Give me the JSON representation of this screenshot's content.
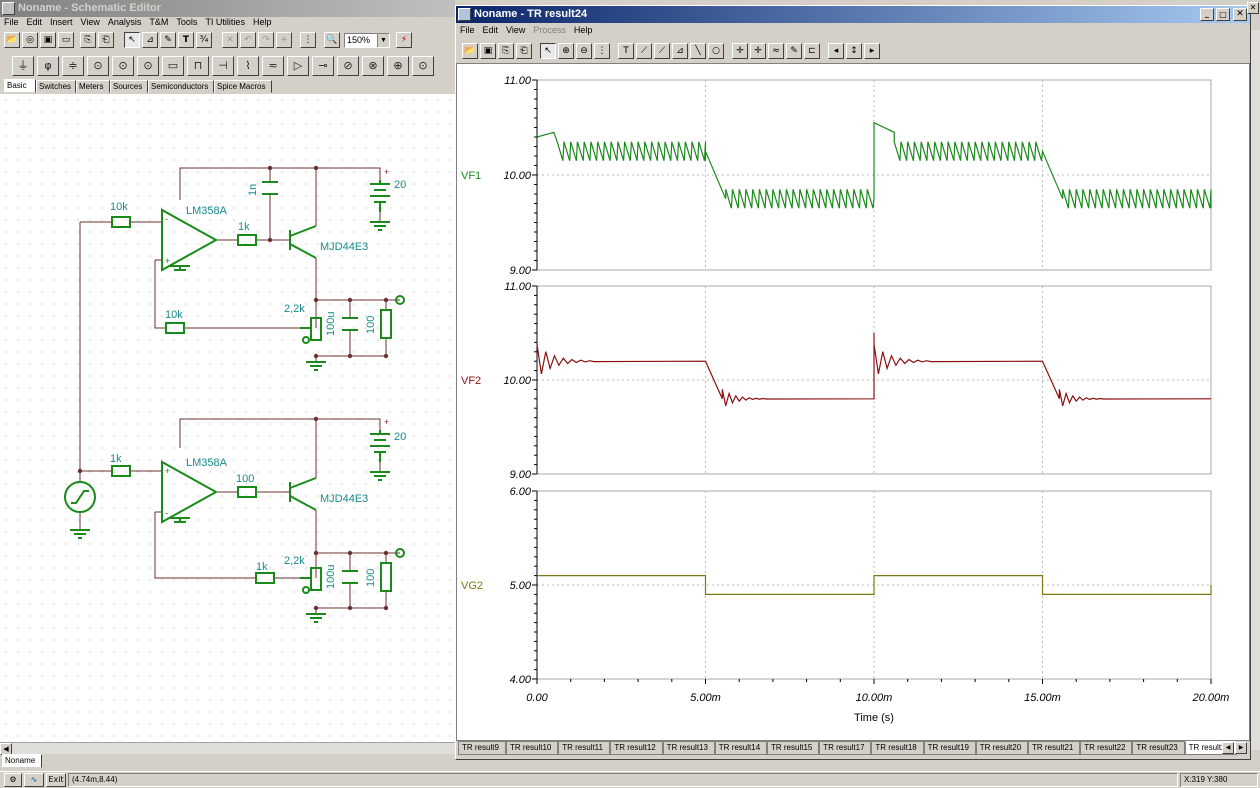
{
  "schematic_window": {
    "title": "Noname - Schematic Editor",
    "menu": [
      "File",
      "Edit",
      "Insert",
      "View",
      "Analysis",
      "T&M",
      "Tools",
      "TI Utilities",
      "Help"
    ],
    "zoom": "150%",
    "component_tabs": [
      "Basic",
      "Switches",
      "Meters",
      "Sources",
      "Semiconductors",
      "Spice Macros"
    ],
    "active_component_tab": "Basic",
    "doc_tab": "Noname",
    "labels": {
      "r_in_top": "10k",
      "opamp_top": "LM358A",
      "r_base_top": "1k",
      "cap_top": "1n",
      "transistor_top": "MJD44E3",
      "battery_top": "20",
      "plus_top": "+",
      "r_fb_top": "10k",
      "pot_top": "2,2k",
      "cap_out_top": "100u",
      "r_load_top": "100",
      "r_in_bot": "1k",
      "opamp_bot": "LM358A",
      "r_base_bot": "100",
      "transistor_bot": "MJD44E3",
      "battery_bot": "20",
      "plus_bot": "+",
      "r_fb_bot": "1k",
      "pot_bot": "2,2k",
      "cap_out_bot": "100u",
      "r_load_bot": "100",
      "plus_sign": "+",
      "minus_sign": "-"
    }
  },
  "result_window": {
    "title": "Noname - TR result24",
    "menu": [
      {
        "label": "File",
        "disabled": false
      },
      {
        "label": "Edit",
        "disabled": false
      },
      {
        "label": "View",
        "disabled": false
      },
      {
        "label": "Process",
        "disabled": true
      },
      {
        "label": "Help",
        "disabled": false
      }
    ],
    "tabs": [
      "TR result9",
      "TR result10",
      "TR result11",
      "TR result12",
      "TR result13",
      "TR result14",
      "TR result15",
      "TR result17",
      "TR result18",
      "TR result19",
      "TR result20",
      "TR result21",
      "TR result22",
      "TR result23",
      "TR result24"
    ],
    "active_tab": "TR result24"
  },
  "chart_data": {
    "type": "line",
    "xlabel": "Time (s)",
    "x_ticks": [
      "0.00",
      "5.00m",
      "10.00m",
      "15.00m",
      "20.00m"
    ],
    "xlim": [
      0,
      0.02
    ],
    "grid": true,
    "panels": [
      {
        "name": "VF1",
        "color": "#1a8a1a",
        "ylim": [
          9.0,
          11.0
        ],
        "y_ticks": [
          "9.00",
          "10.00",
          "11.00"
        ],
        "high": 10.25,
        "low": 9.75,
        "peak": 10.55,
        "initial": 10.4,
        "ripple": 0.2,
        "ripple_count": 25
      },
      {
        "name": "VF2",
        "color": "#8b1010",
        "ylim": [
          9.0,
          11.0
        ],
        "y_ticks": [
          "9.00",
          "10.00",
          "11.00"
        ],
        "high": 10.2,
        "low": 9.8,
        "peak": 10.5,
        "initial": 10.4,
        "ringing": true
      },
      {
        "name": "VG2",
        "color": "#7a7a10",
        "ylim": [
          4.0,
          6.0
        ],
        "y_ticks": [
          "4.00",
          "5.00",
          "6.00"
        ],
        "high": 5.1,
        "low": 4.9
      }
    ]
  },
  "status": {
    "exit_label": "Exit",
    "coords": "(4.74m,8.44)",
    "xy_readout": "X:319  Y:380"
  }
}
